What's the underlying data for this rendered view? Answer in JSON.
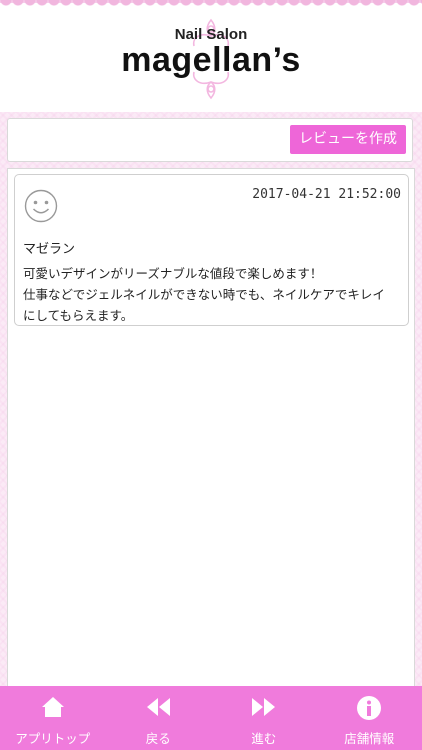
{
  "header": {
    "brand_sub": "Nail Salon",
    "brand_main": "magellan’s"
  },
  "toolbar": {
    "create_review_label": "レビューを作成"
  },
  "reviews": [
    {
      "date": "2017-04-21 21:52:00",
      "author": "マゼラン",
      "lines": [
        "可愛いデザインがリーズナブルな値段で楽しめます！",
        "仕事などでジェルネイルができない時でも、ネイルケアでキレイ",
        "にしてもらえます。"
      ],
      "avatar_icon": "smiley-face-icon"
    }
  ],
  "tabbar": {
    "items": [
      {
        "label": "アプリトップ",
        "icon": "home-icon"
      },
      {
        "label": "戻る",
        "icon": "rewind-icon"
      },
      {
        "label": "進む",
        "icon": "fast-forward-icon"
      },
      {
        "label": "店舗情報",
        "icon": "info-icon"
      }
    ]
  },
  "colors": {
    "accent": "#ee66d8",
    "tabbar": "#f07bdc",
    "background": "#fbeaf6"
  }
}
